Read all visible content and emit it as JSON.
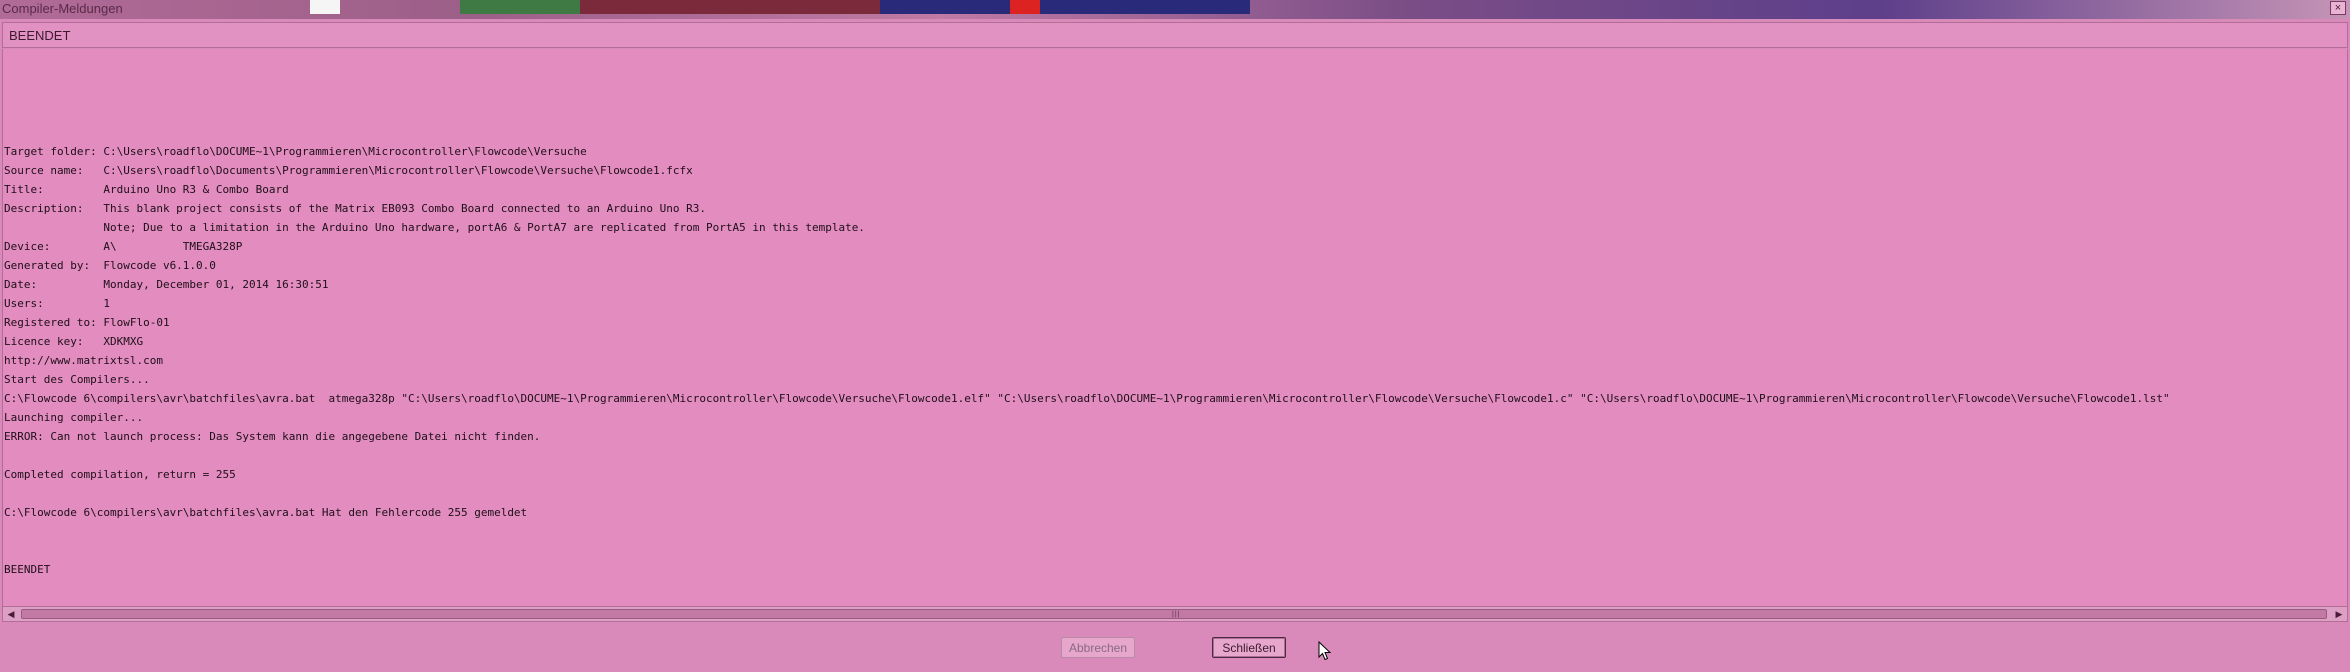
{
  "window": {
    "title": "Compiler-Meldungen",
    "close_glyph": "×"
  },
  "status": {
    "label": "BEENDET"
  },
  "log_lines": [
    "Target folder: C:\\Users\\roadflo\\DOCUME~1\\Programmieren\\Microcontroller\\Flowcode\\Versuche",
    "Source name:   C:\\Users\\roadflo\\Documents\\Programmieren\\Microcontroller\\Flowcode\\Versuche\\Flowcode1.fcfx",
    "Title:         Arduino Uno R3 & Combo Board",
    "Description:   This blank project consists of the Matrix EB093 Combo Board connected to an Arduino Uno R3.",
    "               Note; Due to a limitation in the Arduino Uno hardware, portA6 & PortA7 are replicated from PortA5 in this template.",
    "Device:        A\\          TMEGA328P",
    "Generated by:  Flowcode v6.1.0.0",
    "Date:          Monday, December 01, 2014 16:30:51",
    "Users:         1",
    "Registered to: FlowFlo-01",
    "Licence key:   XDKMXG",
    "http://www.matrixtsl.com",
    "Start des Compilers...",
    "C:\\Flowcode 6\\compilers\\avr\\batchfiles\\avra.bat  atmega328p \"C:\\Users\\roadflo\\DOCUME~1\\Programmieren\\Microcontroller\\Flowcode\\Versuche\\Flowcode1.elf\" \"C:\\Users\\roadflo\\DOCUME~1\\Programmieren\\Microcontroller\\Flowcode\\Versuche\\Flowcode1.c\" \"C:\\Users\\roadflo\\DOCUME~1\\Programmieren\\Microcontroller\\Flowcode\\Versuche\\Flowcode1.lst\"",
    "Launching compiler...",
    "ERROR: Can not launch process: Das System kann die angegebene Datei nicht finden.",
    "",
    "Completed compilation, return = 255",
    "",
    "C:\\Flowcode 6\\compilers\\avr\\batchfiles\\avra.bat Hat den Fehlercode 255 gemeldet",
    "",
    "",
    "BEENDET"
  ],
  "scrollbar": {
    "left_arrow": "◀",
    "right_arrow": "▶",
    "grip": "|||"
  },
  "buttons": {
    "cancel_label": "Abbrechen",
    "close_label": "Schließen"
  },
  "colors": {
    "dialog_bg": "#d88bb9",
    "output_bg": "#e38cc0",
    "text": "#1e0f18"
  },
  "icons": {
    "close": "close-icon",
    "cursor": "mouse-pointer-icon"
  }
}
